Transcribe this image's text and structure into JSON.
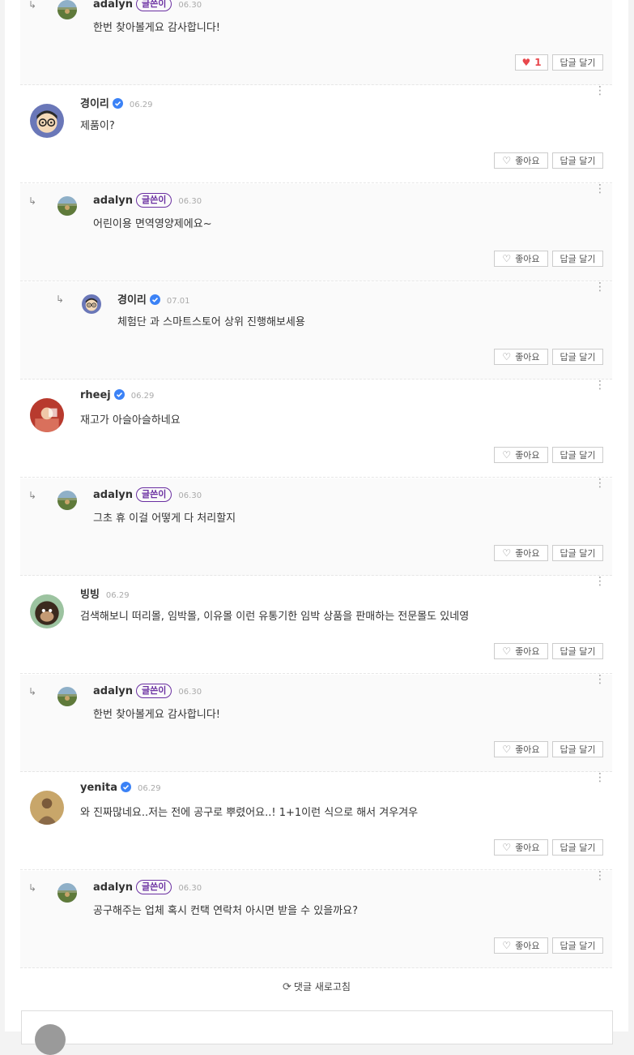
{
  "comments": [
    {
      "kind": "reply",
      "author": "adalyn",
      "badge": "글쓴이",
      "date": "06.30",
      "text": "한번 찾아볼게요 감사합니다!",
      "like_label": "1",
      "liked": true,
      "reply_label": "답글 달기",
      "verified": false,
      "avatar": "landscape"
    },
    {
      "kind": "top",
      "author": "경이리",
      "badge": "",
      "date": "06.29",
      "text": "제품이?",
      "like_label": "좋아요",
      "liked": false,
      "reply_label": "답글 달기",
      "verified": true,
      "avatar": "cartoon"
    },
    {
      "kind": "reply",
      "author": "adalyn",
      "badge": "글쓴이",
      "date": "06.30",
      "text": "어린이용 면역영양제에요~",
      "like_label": "좋아요",
      "liked": false,
      "reply_label": "답글 달기",
      "verified": false,
      "avatar": "landscape"
    },
    {
      "kind": "reply2",
      "author": "경이리",
      "badge": "",
      "date": "07.01",
      "text": "체험단 과 스마트스토어 상위 진행해보세용",
      "like_label": "좋아요",
      "liked": false,
      "reply_label": "답글 달기",
      "verified": true,
      "avatar": "cartoon"
    },
    {
      "kind": "top",
      "author": "rheej",
      "badge": "",
      "date": "06.29",
      "text": "재고가 아슬아슬하네요",
      "like_label": "좋아요",
      "liked": false,
      "reply_label": "답글 달기",
      "verified": true,
      "avatar": "red"
    },
    {
      "kind": "reply",
      "author": "adalyn",
      "badge": "글쓴이",
      "date": "06.30",
      "text": "그초 휴 이걸 어떻게 다 처리할지",
      "like_label": "좋아요",
      "liked": false,
      "reply_label": "답글 달기",
      "verified": false,
      "avatar": "landscape"
    },
    {
      "kind": "top",
      "author": "빙빙",
      "badge": "",
      "date": "06.29",
      "text": "검색해보니 떠리몰, 임박몰, 이유몰 이런 유통기한 임박 상품을 판매하는 전문몰도 있네영",
      "like_label": "좋아요",
      "liked": false,
      "reply_label": "답글 달기",
      "verified": false,
      "avatar": "monkey"
    },
    {
      "kind": "reply",
      "author": "adalyn",
      "badge": "글쓴이",
      "date": "06.30",
      "text": "한번 찾아볼게요 감사합니다!",
      "like_label": "좋아요",
      "liked": false,
      "reply_label": "답글 달기",
      "verified": false,
      "avatar": "landscape"
    },
    {
      "kind": "top",
      "author": "yenita",
      "badge": "",
      "date": "06.29",
      "text": "와 진짜많네요..저는 전에 공구로 뿌렸어요..! 1+1이런 식으로 해서 겨우겨우",
      "like_label": "좋아요",
      "liked": false,
      "reply_label": "답글 달기",
      "verified": true,
      "avatar": "person"
    },
    {
      "kind": "reply",
      "author": "adalyn",
      "badge": "글쓴이",
      "date": "06.30",
      "text": "공구해주는 업체 혹시 컨택 연락처 아시면 받을 수 있을까요?",
      "like_label": "좋아요",
      "liked": false,
      "reply_label": "답글 달기",
      "verified": false,
      "avatar": "landscape"
    }
  ],
  "refresh_label": "댓글 새로고침",
  "icons": {
    "more": "more-vertical-icon",
    "heart": "heart-icon",
    "reply_arrow": "reply-arrow-icon",
    "refresh": "refresh-icon",
    "verified": "verified-check-icon"
  },
  "colors": {
    "accent_badge": "#6a2fa1",
    "liked_heart": "#e8474c",
    "verified": "#3b82f6"
  }
}
